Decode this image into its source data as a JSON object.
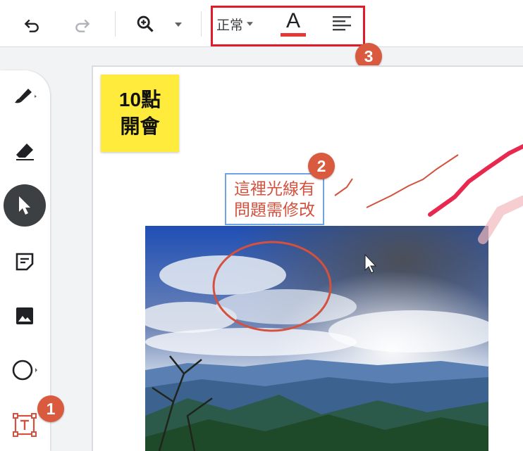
{
  "toolbar": {
    "undo_icon": "undo-icon",
    "redo_icon": "redo-icon",
    "zoom_icon": "zoom-in-icon",
    "text_style_label": "正常",
    "text_color_icon": "text-color-icon",
    "text_color_glyph": "A",
    "text_color": "#e53935",
    "align_icon": "align-left-icon"
  },
  "badges": {
    "one": "1",
    "two": "2",
    "three": "3"
  },
  "sidebar": {
    "tools": [
      {
        "name": "pen-tool",
        "icon": "pen-icon"
      },
      {
        "name": "eraser-tool",
        "icon": "eraser-icon"
      },
      {
        "name": "select-tool",
        "icon": "pointer-icon",
        "active": true
      },
      {
        "name": "sticky-note-tool",
        "icon": "sticky-note-icon"
      },
      {
        "name": "image-tool",
        "icon": "image-icon"
      },
      {
        "name": "shape-tool",
        "icon": "circle-icon"
      },
      {
        "name": "text-box-tool",
        "icon": "text-box-icon"
      }
    ]
  },
  "canvas": {
    "sticky_note": {
      "line1": "10點",
      "line2": "開會",
      "color": "#ffeb3b"
    },
    "text_note": {
      "line1": "這裡光線有",
      "line2": "問題需修改",
      "text_color": "#d4513f",
      "border_color": "#6ea3e8"
    },
    "annotation_color": "#d4513f",
    "highlighter_color": "#e8294f"
  }
}
